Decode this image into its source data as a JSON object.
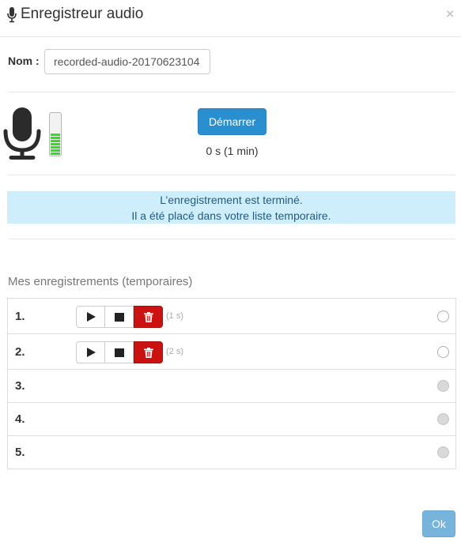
{
  "dialog": {
    "title": "Enregistreur audio",
    "close_glyph": "×",
    "title_icon": "microphone-icon"
  },
  "name_field": {
    "label": "Nom :",
    "value": "recorded-audio-20170623104"
  },
  "recorder": {
    "start_label": "Démarrer",
    "timer_text": "0 s  (1 min)",
    "level_fraction": 0.55,
    "level_color": "#33dd22",
    "mic_icon": "microphone-icon"
  },
  "alert": {
    "line1": "L’enregistrement est terminé.",
    "line2": "Il a été placé dans votre liste temporaire."
  },
  "recordings": {
    "title": "Mes enregistrements (temporaires)",
    "rows": [
      {
        "num": "1.",
        "has_controls": true,
        "duration": "(1 s)",
        "radio_enabled": true
      },
      {
        "num": "2.",
        "has_controls": true,
        "duration": "(2 s)",
        "radio_enabled": true
      },
      {
        "num": "3.",
        "has_controls": false,
        "duration": "",
        "radio_enabled": false
      },
      {
        "num": "4.",
        "has_controls": false,
        "duration": "",
        "radio_enabled": false
      },
      {
        "num": "5.",
        "has_controls": false,
        "duration": "",
        "radio_enabled": false
      }
    ],
    "icons": {
      "play": "play-icon",
      "stop": "stop-icon",
      "delete": "trash-icon"
    }
  },
  "footer": {
    "ok_label": "Ok"
  },
  "colors": {
    "primary": "#2a8fce",
    "primary_disabled": "#76b4dc",
    "danger": "#cc1111",
    "alert_bg": "#cfeefb",
    "alert_text": "#1f5b86"
  }
}
